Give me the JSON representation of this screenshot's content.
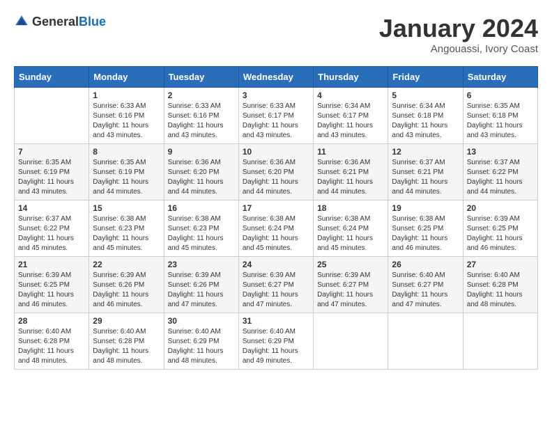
{
  "header": {
    "logo": {
      "text1": "General",
      "text2": "Blue"
    },
    "title": "January 2024",
    "subtitle": "Angouassi, Ivory Coast"
  },
  "weekdays": [
    "Sunday",
    "Monday",
    "Tuesday",
    "Wednesday",
    "Thursday",
    "Friday",
    "Saturday"
  ],
  "weeks": [
    [
      {
        "day": "",
        "sunrise": "",
        "sunset": "",
        "daylight": ""
      },
      {
        "day": "1",
        "sunrise": "Sunrise: 6:33 AM",
        "sunset": "Sunset: 6:16 PM",
        "daylight": "Daylight: 11 hours and 43 minutes."
      },
      {
        "day": "2",
        "sunrise": "Sunrise: 6:33 AM",
        "sunset": "Sunset: 6:16 PM",
        "daylight": "Daylight: 11 hours and 43 minutes."
      },
      {
        "day": "3",
        "sunrise": "Sunrise: 6:33 AM",
        "sunset": "Sunset: 6:17 PM",
        "daylight": "Daylight: 11 hours and 43 minutes."
      },
      {
        "day": "4",
        "sunrise": "Sunrise: 6:34 AM",
        "sunset": "Sunset: 6:17 PM",
        "daylight": "Daylight: 11 hours and 43 minutes."
      },
      {
        "day": "5",
        "sunrise": "Sunrise: 6:34 AM",
        "sunset": "Sunset: 6:18 PM",
        "daylight": "Daylight: 11 hours and 43 minutes."
      },
      {
        "day": "6",
        "sunrise": "Sunrise: 6:35 AM",
        "sunset": "Sunset: 6:18 PM",
        "daylight": "Daylight: 11 hours and 43 minutes."
      }
    ],
    [
      {
        "day": "7",
        "sunrise": "Sunrise: 6:35 AM",
        "sunset": "Sunset: 6:19 PM",
        "daylight": "Daylight: 11 hours and 43 minutes."
      },
      {
        "day": "8",
        "sunrise": "Sunrise: 6:35 AM",
        "sunset": "Sunset: 6:19 PM",
        "daylight": "Daylight: 11 hours and 44 minutes."
      },
      {
        "day": "9",
        "sunrise": "Sunrise: 6:36 AM",
        "sunset": "Sunset: 6:20 PM",
        "daylight": "Daylight: 11 hours and 44 minutes."
      },
      {
        "day": "10",
        "sunrise": "Sunrise: 6:36 AM",
        "sunset": "Sunset: 6:20 PM",
        "daylight": "Daylight: 11 hours and 44 minutes."
      },
      {
        "day": "11",
        "sunrise": "Sunrise: 6:36 AM",
        "sunset": "Sunset: 6:21 PM",
        "daylight": "Daylight: 11 hours and 44 minutes."
      },
      {
        "day": "12",
        "sunrise": "Sunrise: 6:37 AM",
        "sunset": "Sunset: 6:21 PM",
        "daylight": "Daylight: 11 hours and 44 minutes."
      },
      {
        "day": "13",
        "sunrise": "Sunrise: 6:37 AM",
        "sunset": "Sunset: 6:22 PM",
        "daylight": "Daylight: 11 hours and 44 minutes."
      }
    ],
    [
      {
        "day": "14",
        "sunrise": "Sunrise: 6:37 AM",
        "sunset": "Sunset: 6:22 PM",
        "daylight": "Daylight: 11 hours and 45 minutes."
      },
      {
        "day": "15",
        "sunrise": "Sunrise: 6:38 AM",
        "sunset": "Sunset: 6:23 PM",
        "daylight": "Daylight: 11 hours and 45 minutes."
      },
      {
        "day": "16",
        "sunrise": "Sunrise: 6:38 AM",
        "sunset": "Sunset: 6:23 PM",
        "daylight": "Daylight: 11 hours and 45 minutes."
      },
      {
        "day": "17",
        "sunrise": "Sunrise: 6:38 AM",
        "sunset": "Sunset: 6:24 PM",
        "daylight": "Daylight: 11 hours and 45 minutes."
      },
      {
        "day": "18",
        "sunrise": "Sunrise: 6:38 AM",
        "sunset": "Sunset: 6:24 PM",
        "daylight": "Daylight: 11 hours and 45 minutes."
      },
      {
        "day": "19",
        "sunrise": "Sunrise: 6:38 AM",
        "sunset": "Sunset: 6:25 PM",
        "daylight": "Daylight: 11 hours and 46 minutes."
      },
      {
        "day": "20",
        "sunrise": "Sunrise: 6:39 AM",
        "sunset": "Sunset: 6:25 PM",
        "daylight": "Daylight: 11 hours and 46 minutes."
      }
    ],
    [
      {
        "day": "21",
        "sunrise": "Sunrise: 6:39 AM",
        "sunset": "Sunset: 6:25 PM",
        "daylight": "Daylight: 11 hours and 46 minutes."
      },
      {
        "day": "22",
        "sunrise": "Sunrise: 6:39 AM",
        "sunset": "Sunset: 6:26 PM",
        "daylight": "Daylight: 11 hours and 46 minutes."
      },
      {
        "day": "23",
        "sunrise": "Sunrise: 6:39 AM",
        "sunset": "Sunset: 6:26 PM",
        "daylight": "Daylight: 11 hours and 47 minutes."
      },
      {
        "day": "24",
        "sunrise": "Sunrise: 6:39 AM",
        "sunset": "Sunset: 6:27 PM",
        "daylight": "Daylight: 11 hours and 47 minutes."
      },
      {
        "day": "25",
        "sunrise": "Sunrise: 6:39 AM",
        "sunset": "Sunset: 6:27 PM",
        "daylight": "Daylight: 11 hours and 47 minutes."
      },
      {
        "day": "26",
        "sunrise": "Sunrise: 6:40 AM",
        "sunset": "Sunset: 6:27 PM",
        "daylight": "Daylight: 11 hours and 47 minutes."
      },
      {
        "day": "27",
        "sunrise": "Sunrise: 6:40 AM",
        "sunset": "Sunset: 6:28 PM",
        "daylight": "Daylight: 11 hours and 48 minutes."
      }
    ],
    [
      {
        "day": "28",
        "sunrise": "Sunrise: 6:40 AM",
        "sunset": "Sunset: 6:28 PM",
        "daylight": "Daylight: 11 hours and 48 minutes."
      },
      {
        "day": "29",
        "sunrise": "Sunrise: 6:40 AM",
        "sunset": "Sunset: 6:28 PM",
        "daylight": "Daylight: 11 hours and 48 minutes."
      },
      {
        "day": "30",
        "sunrise": "Sunrise: 6:40 AM",
        "sunset": "Sunset: 6:29 PM",
        "daylight": "Daylight: 11 hours and 48 minutes."
      },
      {
        "day": "31",
        "sunrise": "Sunrise: 6:40 AM",
        "sunset": "Sunset: 6:29 PM",
        "daylight": "Daylight: 11 hours and 49 minutes."
      },
      {
        "day": "",
        "sunrise": "",
        "sunset": "",
        "daylight": ""
      },
      {
        "day": "",
        "sunrise": "",
        "sunset": "",
        "daylight": ""
      },
      {
        "day": "",
        "sunrise": "",
        "sunset": "",
        "daylight": ""
      }
    ]
  ]
}
